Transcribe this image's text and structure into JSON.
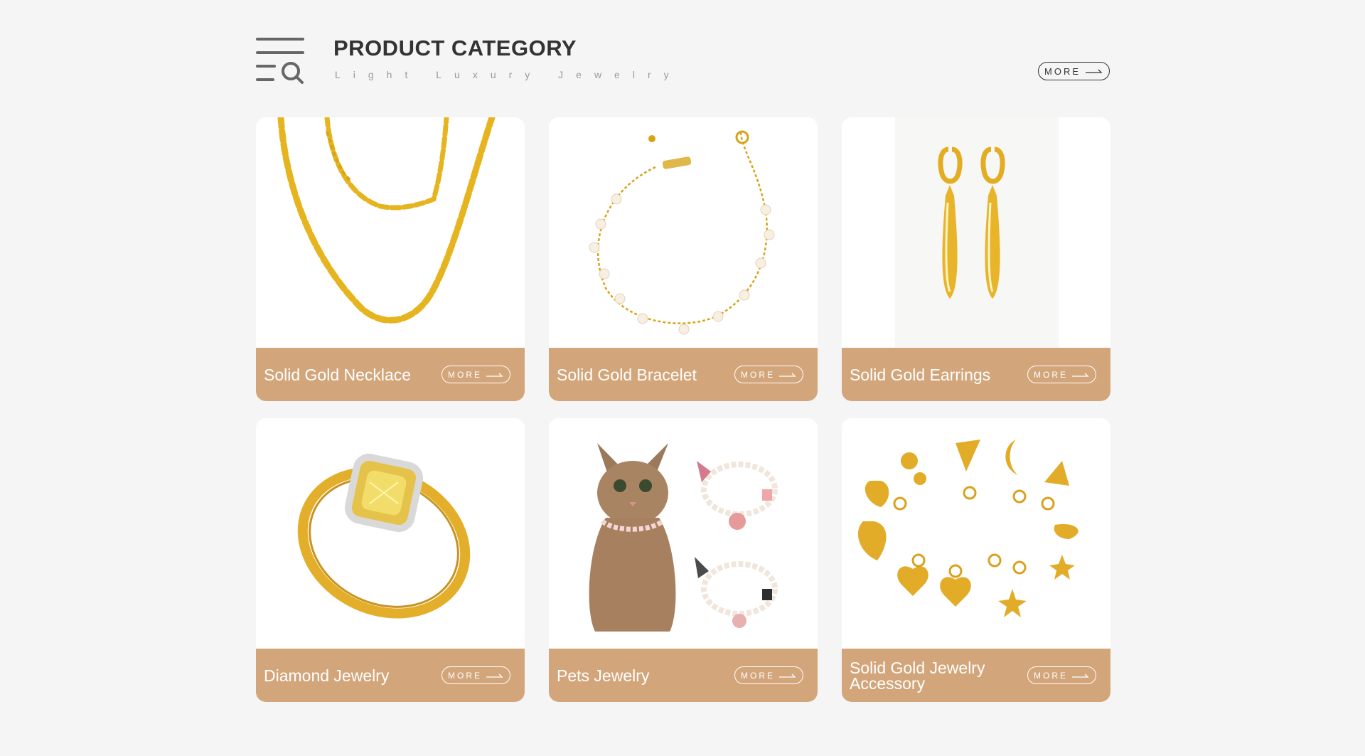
{
  "header": {
    "title": "PRODUCT CATEGORY",
    "subtitle": "Light Luxury Jewelry",
    "more_label": "MORE",
    "icon": "category-search-icon"
  },
  "products": [
    {
      "title": "Solid Gold Necklace",
      "more_label": "MORE",
      "image": "gold-chain-necklace"
    },
    {
      "title": "Solid Gold Bracelet",
      "more_label": "MORE",
      "image": "pearl-gold-bracelet"
    },
    {
      "title": "Solid Gold Earrings",
      "more_label": "MORE",
      "image": "gold-drop-earrings"
    },
    {
      "title": "Diamond Jewelry",
      "more_label": "MORE",
      "image": "yellow-diamond-ring"
    },
    {
      "title": "Pets Jewelry",
      "more_label": "MORE",
      "image": "cat-with-pearl-collars"
    },
    {
      "title": "Solid Gold Jewelry Accessory",
      "more_label": "MORE",
      "image": "gold-charms"
    }
  ],
  "colors": {
    "background": "#f5f5f5",
    "card_bar": "#d3a57a",
    "gold": "#e6b41e",
    "title": "#333333"
  }
}
